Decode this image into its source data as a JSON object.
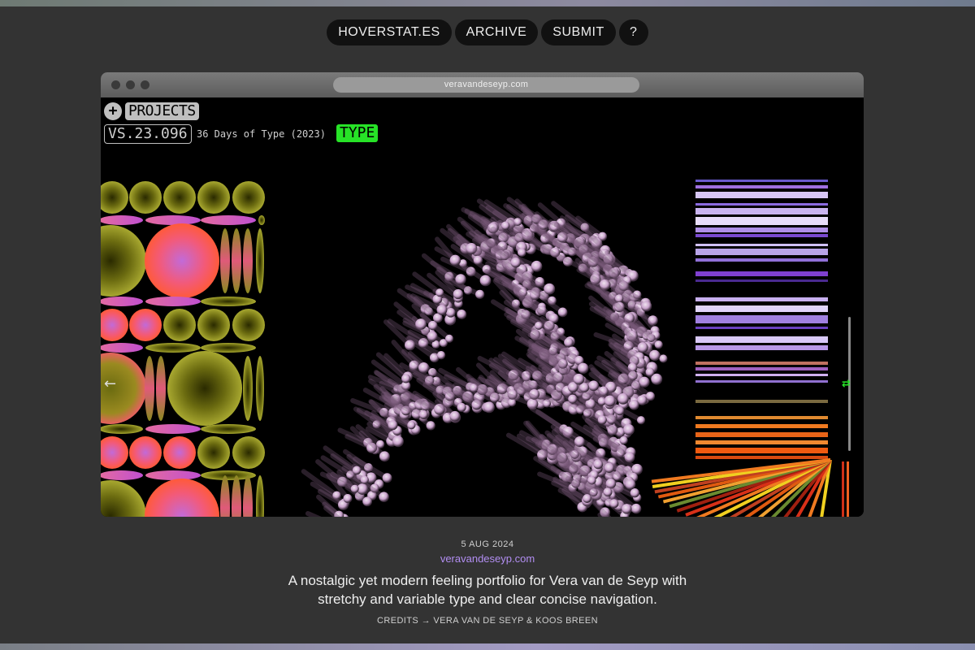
{
  "nav": {
    "items": [
      "HOVERSTAT.ES",
      "ARCHIVE",
      "SUBMIT",
      "?"
    ]
  },
  "browser": {
    "url": "veravandeseyp.com"
  },
  "site": {
    "plus_icon": "+",
    "projects_label": "PROJECTS",
    "version": "VS.23.096",
    "project_title": "36 Days of Type (2023)",
    "tag": "TYPE",
    "tag_color": "#27e327",
    "left_arrow": "←",
    "right_arrow": "⇄"
  },
  "entry": {
    "date": "5 AUG 2024",
    "link": "veravandeseyp.com",
    "description": "A nostalgic yet modern feeling portfolio for Vera van de Seyp with stretchy and variable type and clear concise navigation.",
    "credits": "CREDITS → VERA VAN DE SEYP & KOOS BREEN"
  },
  "colors": {
    "page_bg": "#333333",
    "accent_link": "#b28ef2"
  }
}
